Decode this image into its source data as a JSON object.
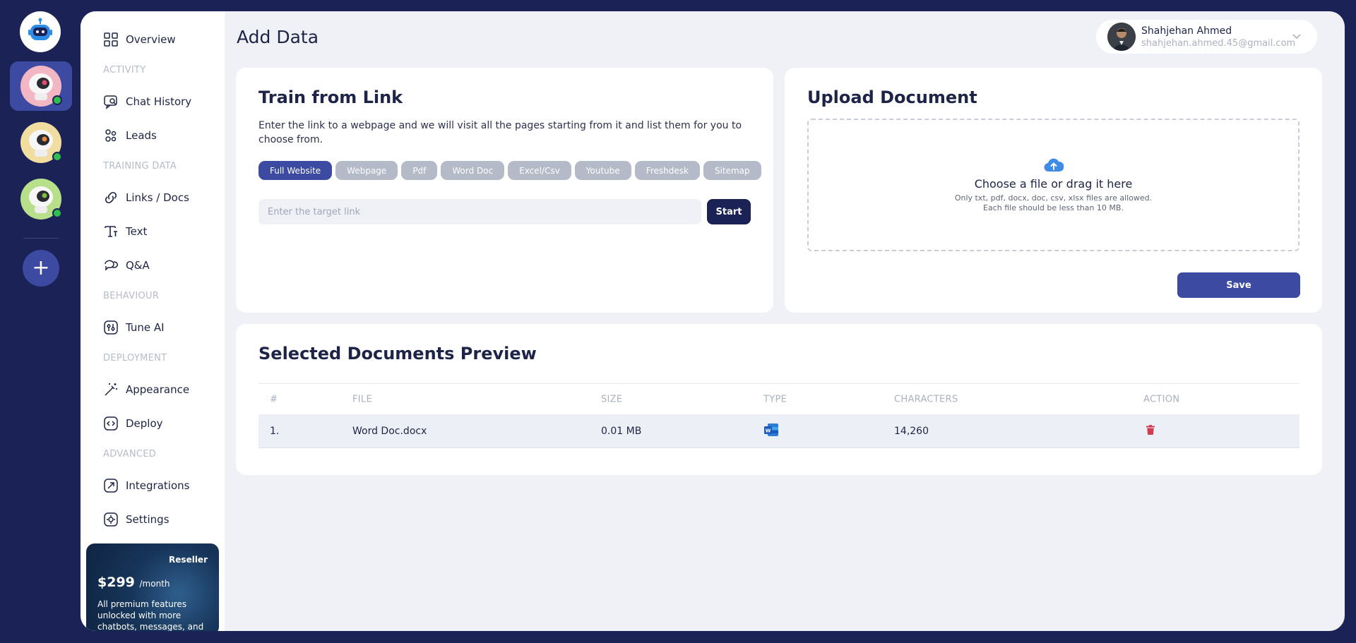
{
  "sidebar": {
    "items": [
      {
        "label": "Overview",
        "icon": "grid-icon"
      },
      {
        "label": "Chat History",
        "icon": "chat-history-icon"
      },
      {
        "label": "Leads",
        "icon": "leads-icon"
      },
      {
        "label": "Links / Docs",
        "icon": "link-icon"
      },
      {
        "label": "Text",
        "icon": "text-icon"
      },
      {
        "label": "Q&A",
        "icon": "qa-icon"
      },
      {
        "label": "Tune AI",
        "icon": "tune-icon"
      },
      {
        "label": "Appearance",
        "icon": "magic-wand-icon"
      },
      {
        "label": "Deploy",
        "icon": "code-icon"
      },
      {
        "label": "Integrations",
        "icon": "integrations-icon"
      },
      {
        "label": "Settings",
        "icon": "settings-icon"
      }
    ],
    "sections": {
      "activity": "ACTIVITY",
      "training": "TRAINING DATA",
      "behaviour": "BEHAVIOUR",
      "deployment": "DEPLOYMENT",
      "advanced": "ADVANCED"
    },
    "promo": {
      "tag": "Reseller",
      "price": "$299",
      "period": "/month",
      "desc": "All premium features unlocked with more chatbots, messages, and"
    }
  },
  "header": {
    "title": "Add Data",
    "user_name": "Shahjehan Ahmed",
    "user_email": "shahjehan.ahmed.45@gmail.com"
  },
  "train": {
    "title": "Train from Link",
    "desc": "Enter the link to a webpage and we will visit all the pages starting from it and list them for you to choose from.",
    "chips": [
      "Full Website",
      "Webpage",
      "Pdf",
      "Word Doc",
      "Excel/Csv",
      "Youtube",
      "Freshdesk",
      "Sitemap"
    ],
    "input_placeholder": "Enter the target link",
    "start_label": "Start"
  },
  "upload": {
    "title": "Upload Document",
    "main": "Choose a file or drag it here",
    "hint1": "Only txt, pdf, docx, doc, csv, xlsx files are allowed.",
    "hint2": "Each file should be less than 10 MB.",
    "save_label": "Save"
  },
  "preview": {
    "title": "Selected Documents Preview",
    "columns": [
      "#",
      "FILE",
      "SIZE",
      "TYPE",
      "CHARACTERS",
      "ACTION"
    ],
    "rows": [
      {
        "index": "1.",
        "file": "Word Doc.docx",
        "size": "0.01 MB",
        "type_icon": "word-icon",
        "characters": "14,260",
        "action_icon": "trash-icon"
      }
    ]
  },
  "colors": {
    "brand": "#1b2256",
    "accent": "#3c4aa1",
    "online": "#2fbf4f",
    "danger": "#d23c4f"
  }
}
